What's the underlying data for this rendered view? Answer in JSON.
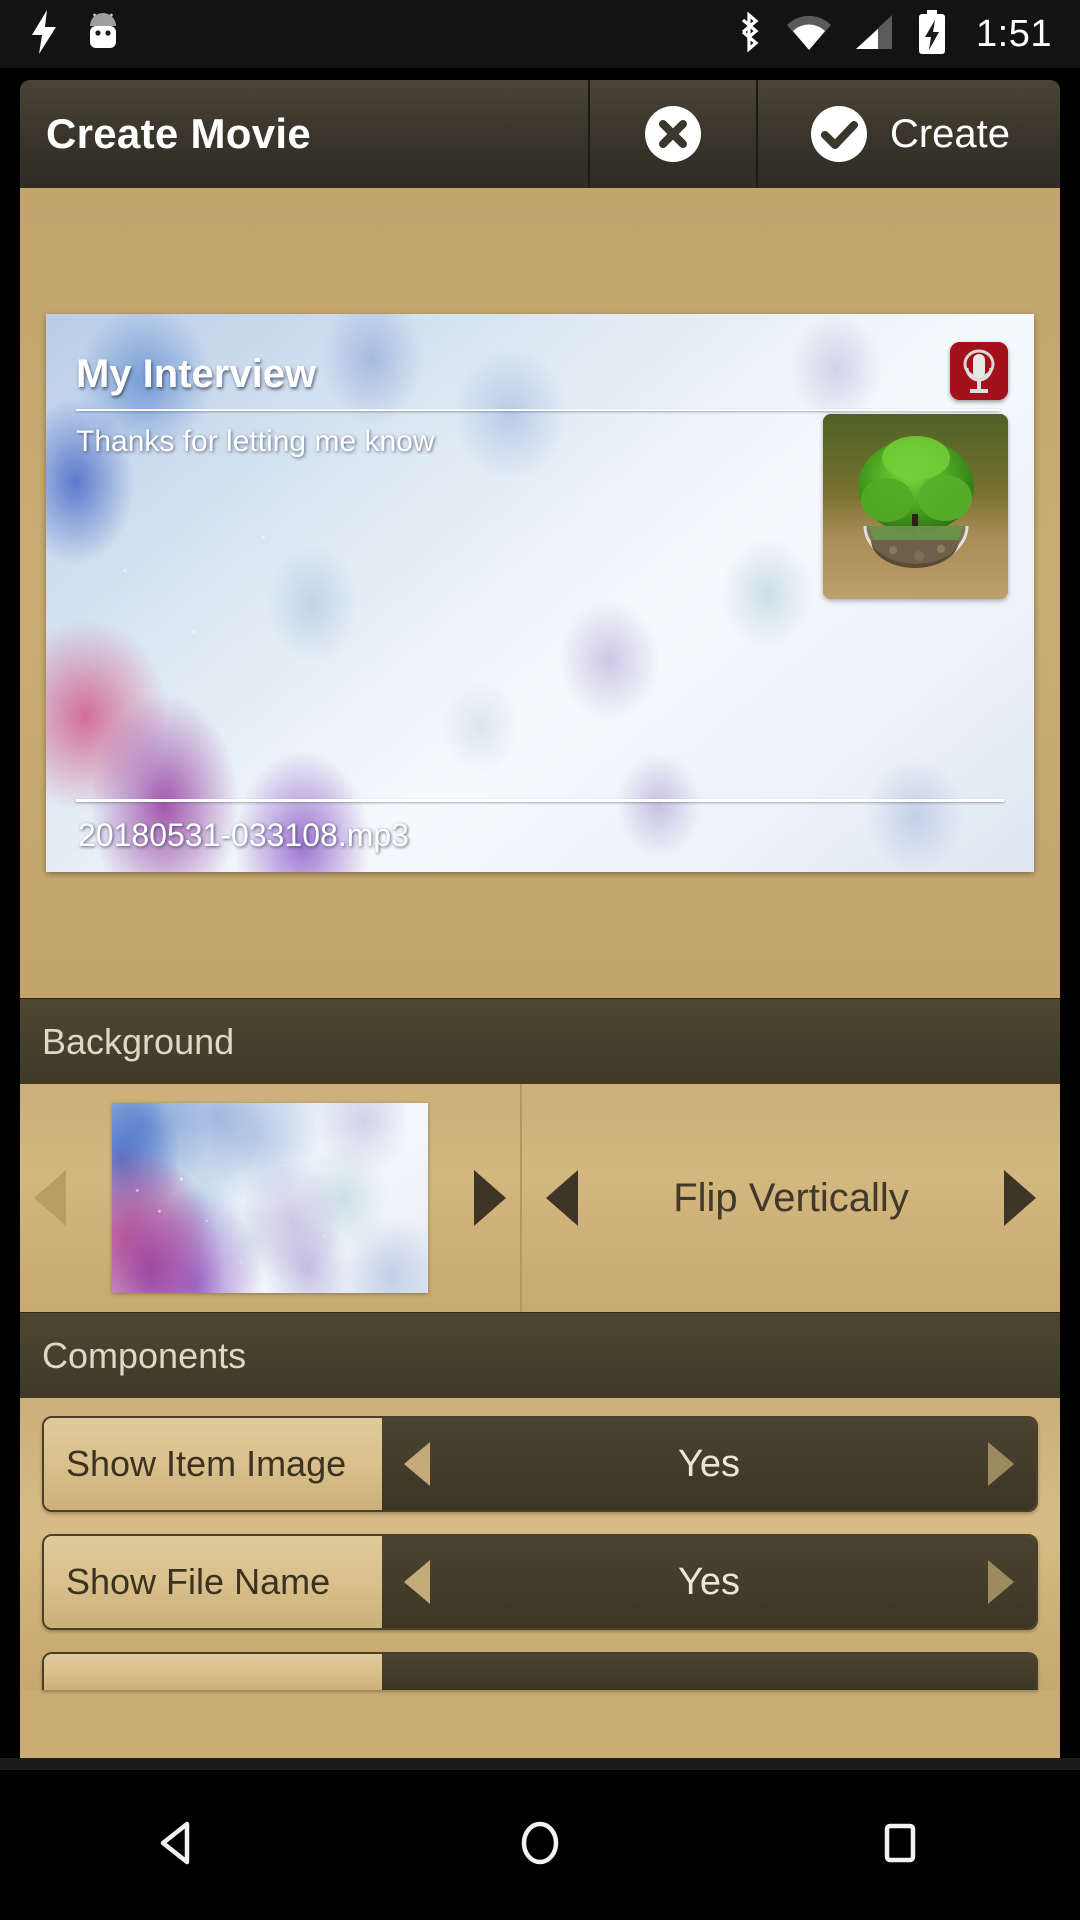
{
  "status_bar": {
    "icons": [
      "flash-icon",
      "android-robot-icon",
      "bluetooth-icon",
      "wifi-icon",
      "cell-signal-icon",
      "battery-charging-icon"
    ],
    "clock": "1:51"
  },
  "app_bar": {
    "title": "Create Movie",
    "close_icon": "close-circle-icon",
    "create_icon": "check-circle-icon",
    "create_label": "Create"
  },
  "preview": {
    "title": "My Interview",
    "subtitle": "Thanks for letting me know",
    "file_name": "20180531-033108.mp3",
    "app_icon": "recorder-app-icon",
    "item_image": "tree-in-glass-bowl-image"
  },
  "background_section": {
    "header": "Background",
    "thumbnail": "watercolor-leaves-background",
    "prev_icon": "triangle-left-icon",
    "next_icon": "triangle-right-icon",
    "flip_prev_icon": "triangle-left-icon",
    "flip_value": "Flip Vertically",
    "flip_next_icon": "triangle-right-icon"
  },
  "components_section": {
    "header": "Components",
    "rows": [
      {
        "label": "Show Item Image",
        "value": "Yes",
        "prev_icon": "triangle-left-icon",
        "next_icon": "triangle-right-icon"
      },
      {
        "label": "Show File Name",
        "value": "Yes",
        "prev_icon": "triangle-left-icon",
        "next_icon": "triangle-right-icon"
      }
    ]
  },
  "nav_bar": {
    "back_icon": "triangle-back-icon",
    "home_icon": "circle-home-icon",
    "recents_icon": "square-recents-icon"
  },
  "colors": {
    "app_bar": "#3b372c",
    "sheet": "#c9ab73",
    "section_header": "#47402c",
    "value_dark": "#443d2a",
    "label_tan": "#d9c08c"
  }
}
